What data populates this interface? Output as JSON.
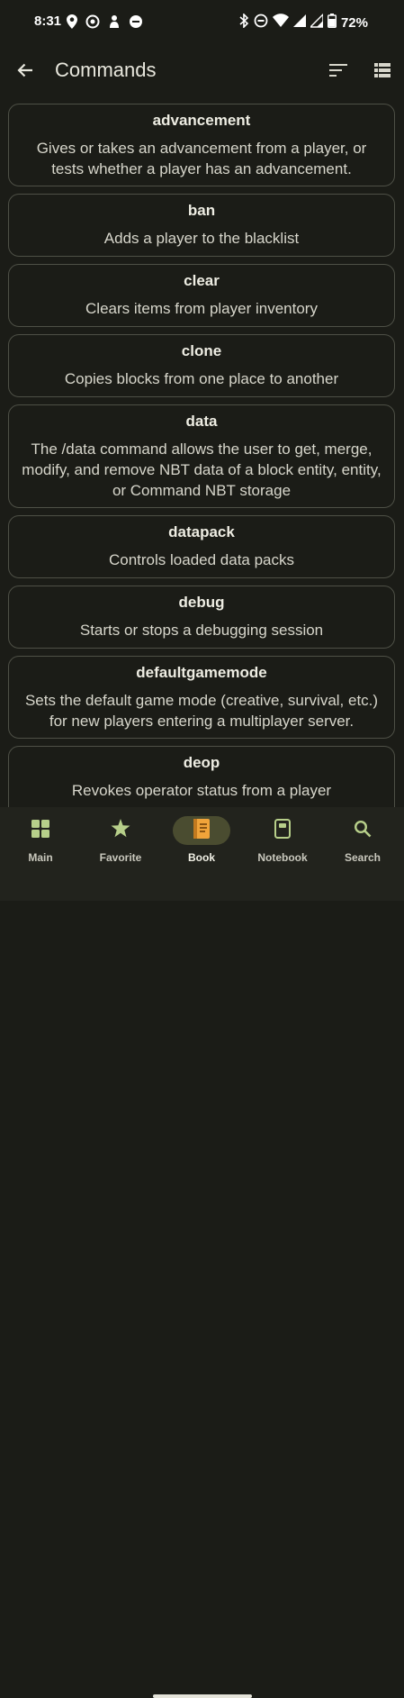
{
  "status_bar": {
    "time": "8:31",
    "battery": "72%",
    "left_icons": [
      "location-pin-icon",
      "target-icon",
      "vpn-key-icon",
      "do-not-disturb-icon"
    ],
    "right_icons": [
      "bluetooth-icon",
      "do-not-disturb-icon",
      "wifi-icon",
      "signal-icon",
      "signal-icon",
      "battery-icon"
    ]
  },
  "app_bar": {
    "title": "Commands",
    "back_icon": "arrow-back-icon",
    "sort_icon": "sort-icon",
    "view_icon": "list-view-icon"
  },
  "commands": [
    {
      "name": "advancement",
      "description": "Gives or takes an advancement from a player, or tests whether a player has an advancement."
    },
    {
      "name": "ban",
      "description": "Adds a player to the blacklist"
    },
    {
      "name": "clear",
      "description": "Clears items from player inventory"
    },
    {
      "name": "clone",
      "description": "Copies blocks from one place to another"
    },
    {
      "name": "data",
      "description": "The /data command allows the user to get, merge, modify, and remove NBT data of a block entity, entity, or Command NBT storage"
    },
    {
      "name": "datapack",
      "description": "Controls loaded data packs"
    },
    {
      "name": "debug",
      "description": "Starts or stops a debugging session"
    },
    {
      "name": "defaultgamemode",
      "description": "Sets the default game mode (creative, survival, etc.) for new players entering a multiplayer server."
    },
    {
      "name": "deop",
      "description": "Revokes operator status from a player"
    }
  ],
  "bottom_nav": {
    "active": "Book",
    "items": [
      {
        "label": "Main",
        "icon": "grid-icon"
      },
      {
        "label": "Favorite",
        "icon": "star-icon"
      },
      {
        "label": "Book",
        "icon": "book-icon"
      },
      {
        "label": "Notebook",
        "icon": "notebook-icon"
      },
      {
        "label": "Search",
        "icon": "search-icon"
      }
    ]
  },
  "colors": {
    "background": "#1b1c17",
    "card_border": "#4e5046",
    "nav_background": "#22231d",
    "nav_active_pill": "#4a4c30",
    "icon_green": "#b7cf8a",
    "book_orange": "#f0a43a"
  }
}
